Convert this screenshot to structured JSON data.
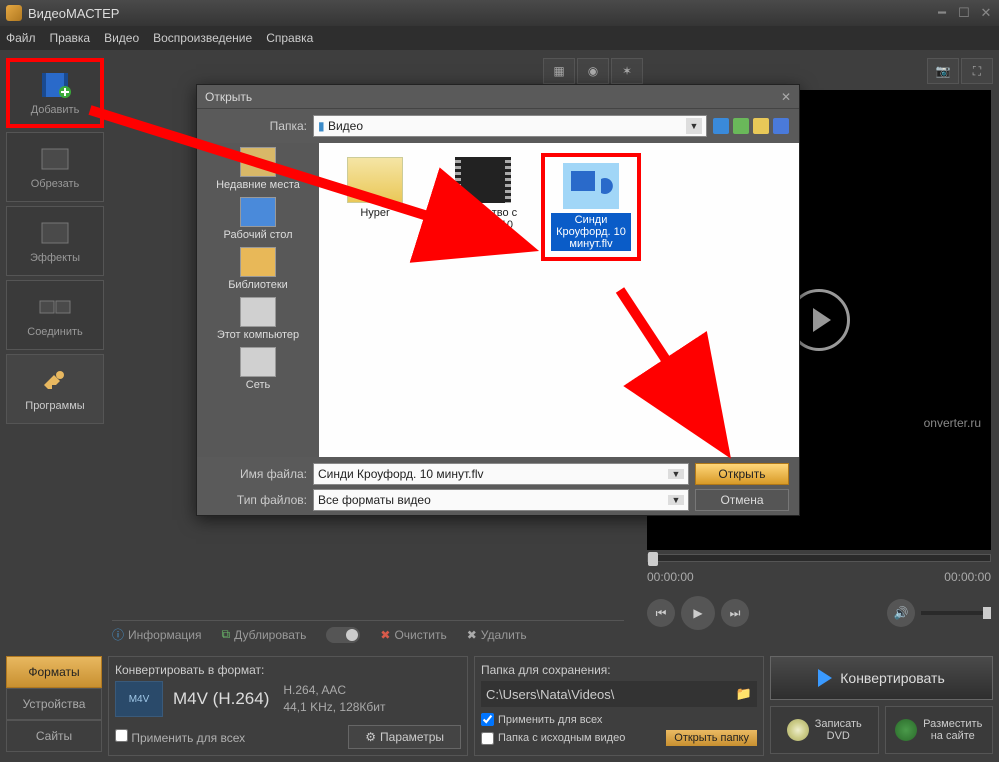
{
  "app": {
    "title": "ВидеоМАСТЕР"
  },
  "menu": {
    "file": "Файл",
    "edit": "Правка",
    "video": "Видео",
    "play": "Воспроизведение",
    "help": "Справка"
  },
  "sidebar": {
    "add": "Добавить",
    "crop": "Обрезать",
    "effects": "Эффекты",
    "join": "Соединить",
    "programs": "Программы"
  },
  "midtools": {
    "info": "Информация",
    "dup": "Дублировать",
    "clear": "Очистить",
    "del": "Удалить"
  },
  "timeline": {
    "start": "00:00:00",
    "end": "00:00:00"
  },
  "watermark": "onverter.ru",
  "bottom": {
    "tabs": {
      "formats": "Форматы",
      "devices": "Устройства",
      "sites": "Сайты"
    },
    "convert_to": "Конвертировать в формат:",
    "format_badge": "M4V",
    "format_name": "M4V (H.264)",
    "codec": "H.264, AAC",
    "audio": "44,1 KHz, 128Кбит",
    "apply_all": "Применить для всех",
    "params": "Параметры",
    "save_to": "Папка для сохранения:",
    "path": "C:\\Users\\Nata\\Videos\\",
    "ck_apply": "Применить для всех",
    "ck_src": "Папка с исходным видео",
    "open_folder": "Открыть папку",
    "convert": "Конвертировать",
    "dvd": "Записать\nDVD",
    "site": "Разместить\nна сайте"
  },
  "dialog": {
    "title": "Открыть",
    "folder_label": "Папка:",
    "folder_value": "Видео",
    "places": [
      "Недавние места",
      "Рабочий стол",
      "Библиотеки",
      "Этот компьютер",
      "Сеть"
    ],
    "files": {
      "f1": "Hyper",
      "f2": "Знакомство с Windows 10",
      "f3": "Синди Кроуфорд. 10 минут.flv"
    },
    "filename_label": "Имя файла:",
    "filename_value": "Синди Кроуфорд. 10 минут.flv",
    "filetype_label": "Тип файлов:",
    "filetype_value": "Все форматы видео",
    "open": "Открыть",
    "cancel": "Отмена"
  }
}
